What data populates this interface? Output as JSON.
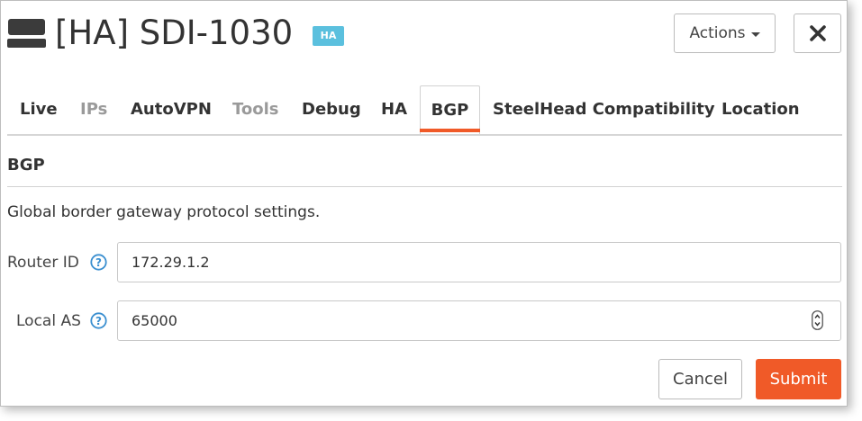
{
  "header": {
    "device_icon": "server-appliance-icon",
    "title": "[HA] SDI-1030",
    "badge": "HA",
    "actions_label": "Actions",
    "close_icon": "close-icon"
  },
  "tabs": [
    {
      "label": "Live",
      "state": "enabled"
    },
    {
      "label": "IPs",
      "state": "disabled"
    },
    {
      "label": "AutoVPN",
      "state": "enabled"
    },
    {
      "label": "Tools",
      "state": "disabled"
    },
    {
      "label": "Debug",
      "state": "enabled"
    },
    {
      "label": "HA",
      "state": "enabled"
    },
    {
      "label": "BGP",
      "state": "active"
    },
    {
      "label": "SteelHead Compatibility",
      "state": "enabled"
    },
    {
      "label": "Location",
      "state": "enabled"
    }
  ],
  "section": {
    "title": "BGP",
    "description": "Global border gateway protocol settings."
  },
  "fields": {
    "router_id": {
      "label": "Router ID",
      "value": "172.29.1.2"
    },
    "local_as": {
      "label": "Local AS",
      "value": "65000"
    }
  },
  "buttons": {
    "cancel": "Cancel",
    "submit": "Submit"
  },
  "colors": {
    "accent": "#f05a28",
    "badge": "#5bc0de",
    "help_icon": "#3a8fd0"
  }
}
